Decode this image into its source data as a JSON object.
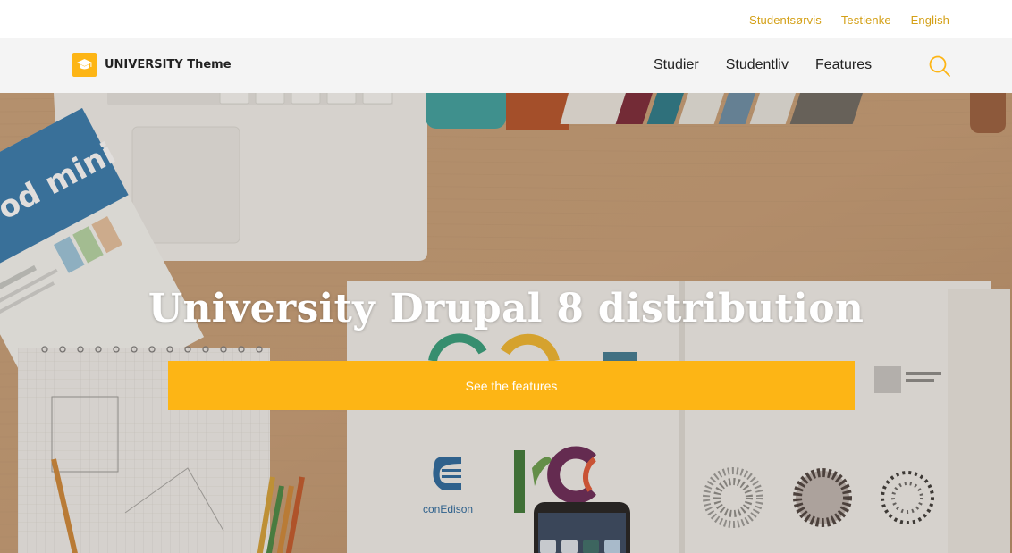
{
  "utility": {
    "links": [
      "Studentsørvis",
      "Testienke",
      "English"
    ]
  },
  "header": {
    "logo_text": "UNIVERSITY Theme",
    "nav": [
      "Studier",
      "Studentliv",
      "Features"
    ]
  },
  "hero": {
    "title": "University Drupal 8 distribution",
    "cta_label": "See the features",
    "magazine_title": "Pod mini",
    "logo_text": "conEdison"
  },
  "colors": {
    "accent": "#fdb515",
    "utility_link": "#d4a017",
    "header_bg": "#f4f4f4",
    "desk": "#c9a47e"
  },
  "icons": {
    "logo": "graduation-cap-icon",
    "search": "search-icon"
  }
}
